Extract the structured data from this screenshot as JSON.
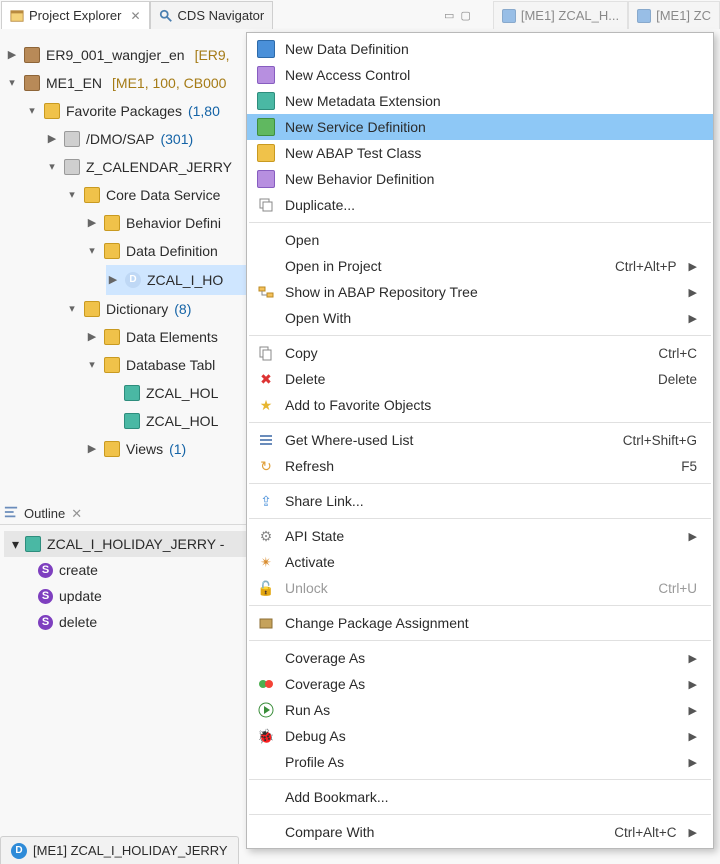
{
  "tabs": {
    "project_explorer": "Project Explorer",
    "cds_navigator": "CDS Navigator",
    "editor_a": "[ME1] ZCAL_H...",
    "editor_b": "[ME1] ZC"
  },
  "tree": {
    "node0": {
      "label": "ER9_001_wangjer_en",
      "suffix": "[ER9,"
    },
    "node1": {
      "label": "ME1_EN",
      "suffix": "[ME1, 100, CB000"
    },
    "fav": {
      "label": "Favorite Packages",
      "count": "(1,80"
    },
    "dmo": {
      "label": "/DMO/SAP",
      "count": "(301)"
    },
    "zcal": {
      "label": "Z_CALENDAR_JERRY"
    },
    "cds": {
      "label": "Core Data Service"
    },
    "bdef": {
      "label": "Behavior Defini"
    },
    "ddef": {
      "label": "Data Definition"
    },
    "ddef_entry": {
      "label": "ZCAL_I_HO"
    },
    "dict": {
      "label": "Dictionary",
      "count": "(8)"
    },
    "delem": {
      "label": "Data Elements"
    },
    "dbtab": {
      "label": "Database Tabl"
    },
    "dbtab_e1": {
      "label": "ZCAL_HOL"
    },
    "dbtab_e2": {
      "label": "ZCAL_HOL"
    },
    "views": {
      "label": "Views",
      "count": "(1)"
    }
  },
  "outline_view": {
    "title": "Outline",
    "root_label": "ZCAL_I_HOLIDAY_JERRY - ",
    "items": [
      "create",
      "update",
      "delete"
    ]
  },
  "editor_bar": {
    "tab": "[ME1] ZCAL_I_HOLIDAY_JERRY"
  },
  "menu": {
    "new_data_def": "New Data Definition",
    "new_acc_ctrl": "New Access Control",
    "new_meta_ext": "New Metadata Extension",
    "new_srv_def": "New Service Definition",
    "new_abap_test": "New ABAP Test Class",
    "new_beh_def": "New Behavior Definition",
    "duplicate": "Duplicate...",
    "open": "Open",
    "open_in_project": "Open in Project",
    "open_in_project_s": "Ctrl+Alt+P",
    "show_repo": "Show in ABAP Repository Tree",
    "open_with": "Open With",
    "copy": "Copy",
    "copy_s": "Ctrl+C",
    "delete": "Delete",
    "delete_s": "Delete",
    "add_fav": "Add to Favorite Objects",
    "where_used": "Get Where-used List",
    "where_used_s": "Ctrl+Shift+G",
    "refresh": "Refresh",
    "refresh_s": "F5",
    "share": "Share Link...",
    "api_state": "API State",
    "activate": "Activate",
    "unlock": "Unlock",
    "unlock_s": "Ctrl+U",
    "change_pkg": "Change Package Assignment",
    "coverage_as": "Coverage As",
    "coverage_as2": "Coverage As",
    "run_as": "Run As",
    "debug_as": "Debug As",
    "profile_as": "Profile As",
    "add_bookmark": "Add Bookmark...",
    "compare_with": "Compare With",
    "compare_with_s": "Ctrl+Alt+C"
  }
}
